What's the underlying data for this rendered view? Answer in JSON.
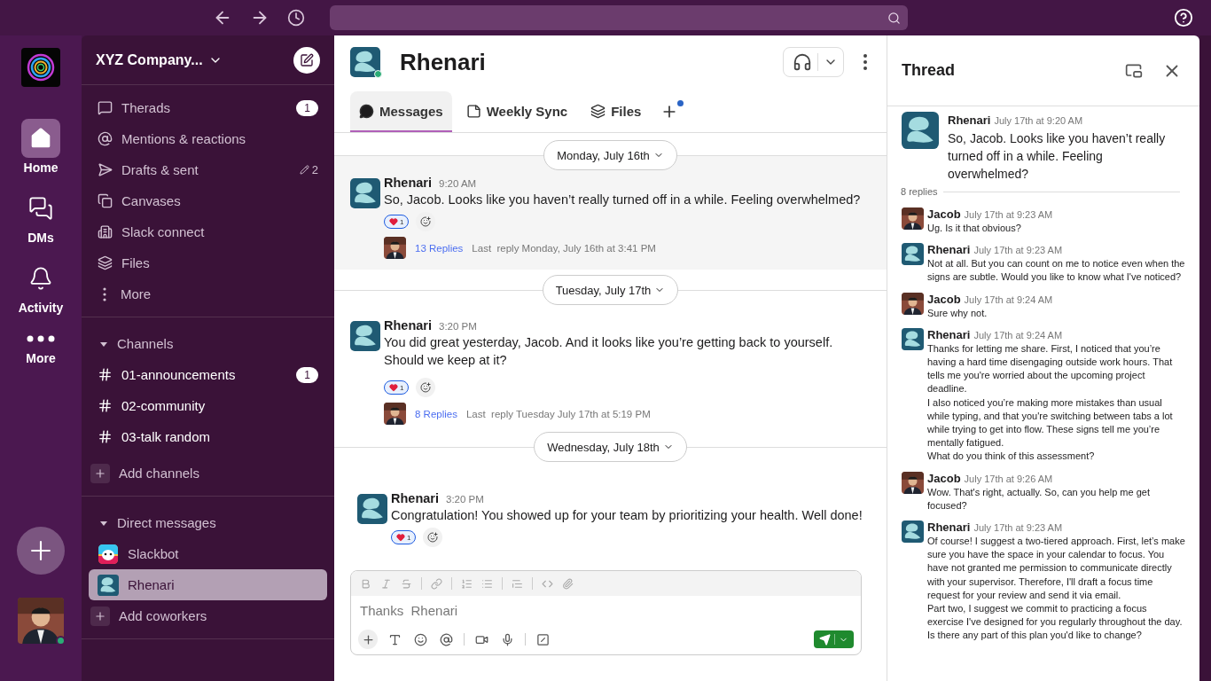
{
  "rail": {
    "items": [
      {
        "label": "Home",
        "selected": true
      },
      {
        "label": "DMs",
        "selected": false
      },
      {
        "label": "Activity",
        "selected": false
      },
      {
        "label": "More",
        "selected": false
      }
    ]
  },
  "sidebar": {
    "workspace": "XYZ Company...",
    "nav": [
      {
        "kind": "badge",
        "label": "Therads",
        "count": "1"
      },
      {
        "kind": "plain",
        "label": "Mentions & reactions"
      },
      {
        "kind": "draft",
        "label": "Drafts & sent",
        "count": "2"
      },
      {
        "kind": "plain",
        "label": "Canvases"
      },
      {
        "kind": "plain",
        "label": "Slack connect"
      },
      {
        "kind": "plain",
        "label": "Files"
      },
      {
        "kind": "plain",
        "label": "More"
      }
    ],
    "channels": {
      "title": "Channels",
      "expanded": true,
      "items": [
        {
          "label": "01-announcements",
          "count": "1"
        },
        {
          "label": "02-community"
        },
        {
          "label": "03-talk random"
        }
      ],
      "add": "Add channels"
    },
    "dms": {
      "title": "Direct messages",
      "expanded": true,
      "items": [
        {
          "label": "Slackbot",
          "kind": "bot",
          "selected": false
        },
        {
          "label": "Rhenari",
          "kind": "rhenari",
          "selected": true
        }
      ],
      "add": "Add coworkers"
    }
  },
  "channel": {
    "name": "Rhenari",
    "online": true,
    "tabs": [
      {
        "label": "Messages",
        "selected": true
      },
      {
        "label": "Weekly Sync",
        "selected": false
      },
      {
        "label": "Files",
        "selected": false
      }
    ],
    "add_tab_dot": true
  },
  "days": [
    {
      "date": "Monday, July 16th",
      "messages": [
        {
          "author": "Rhenari",
          "time": "9:20 AM",
          "highlighted": true,
          "text": [
            "So, Jacob. Looks like you haven’t really turned off in a while. Feeling overwhelmed?"
          ],
          "reaction_count": "1",
          "replies": "13 Replies",
          "last_reply": "Last  reply Monday, July 16th at 3:41 PM"
        }
      ]
    },
    {
      "date": "Tuesday, July 17th",
      "messages": [
        {
          "author": "Rhenari",
          "time": "3:20 PM",
          "highlighted": false,
          "text": [
            "You did great yesterday, Jacob. And it looks like you’re getting back to yourself.",
            "Should we keep at it?"
          ],
          "reaction_count": "1",
          "replies": "8 Replies",
          "last_reply": "Last  reply Tuesday July 17th at 5:19 PM"
        }
      ]
    },
    {
      "date": "Wednesday, July 18th",
      "messages": [
        {
          "author": "Rhenari",
          "time": "3:20 PM",
          "highlighted": false,
          "text": [
            "Congratulation! You showed up for your team by prioritizing your health. Well done!"
          ],
          "reaction_count": "1"
        }
      ]
    }
  ],
  "composer": {
    "placeholder": "Thanks  Rhenari"
  },
  "thread": {
    "title": "Thread",
    "root": {
      "author": "Rhenari",
      "time": "July 17th at 9:20 AM",
      "text": "So, Jacob. Looks like you haven’t really turned off in a while. Feeling overwhelmed?"
    },
    "reply_count": "8 replies",
    "replies": [
      {
        "kind": "user",
        "author": "Jacob",
        "time": "July 17th at 9:23 AM",
        "text": [
          "Ug.  Is it that obvious?"
        ]
      },
      {
        "kind": "bot",
        "author": "Rhenari",
        "time": "July 17th at 9:23 AM",
        "text": [
          "Not at all. But you can count on me to notice even when the signs are subtle. Would you like to know what I've noticed?"
        ]
      },
      {
        "kind": "user",
        "author": "Jacob",
        "time": "July 17th at 9:24 AM",
        "text": [
          "Sure why not."
        ]
      },
      {
        "kind": "bot",
        "author": "Rhenari",
        "time": "July 17th at 9:24 AM",
        "text": [
          "Thanks for letting me share. First, I noticed that you’re having a hard time disengaging outside work hours. That tells me you're worried about the upcoming project deadline.",
          "I also noticed you’re making more mistakes than usual while typing, and that you're switching between tabs a lot while trying to get into flow. These signs tell me you’re mentally fatigued.",
          "What do you think of this assessment?"
        ]
      },
      {
        "kind": "user",
        "author": "Jacob",
        "time": "July 17th at 9:26 AM",
        "text": [
          "Wow. That's right, actually. So, can you help me get focused?"
        ]
      },
      {
        "kind": "bot",
        "author": "Rhenari",
        "time": "July 17th at 9:23 AM",
        "text": [
          "Of course! I suggest a two-tiered approach. First, let’s make sure you have the space in your calendar to focus. You have not granted me permission to communicate directly with your supervisor. Therefore, I'll draft a focus time request for your review and send it via email.",
          "Part two, I suggest we commit to practicing a focus exercise I've designed for you regularly throughout the day.",
          "Is there any part of this plan you'd like to change?"
        ]
      }
    ]
  }
}
